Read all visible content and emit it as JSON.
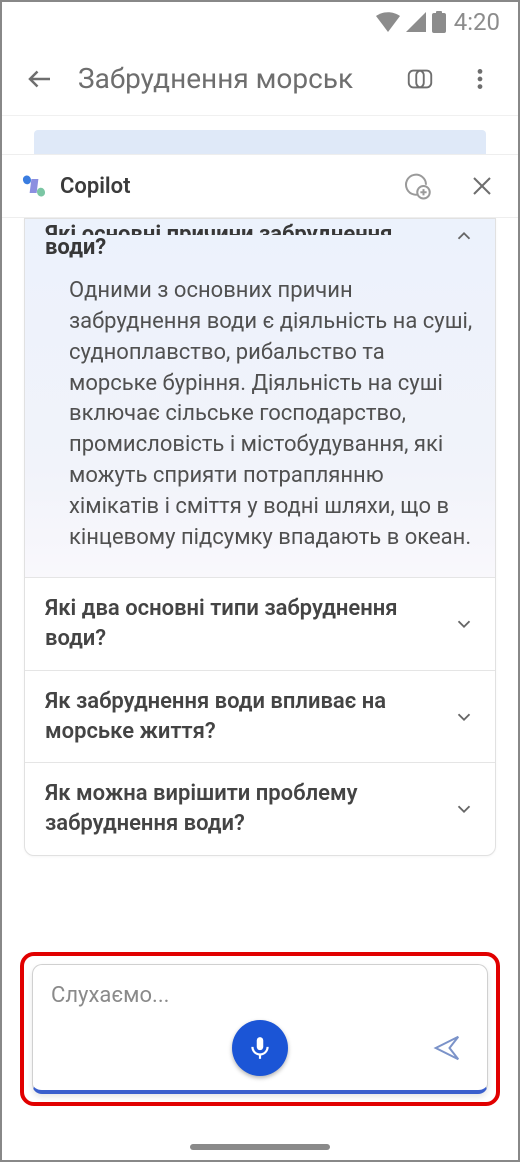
{
  "status": {
    "time": "4:20"
  },
  "app_header": {
    "title": "Забруднення морськ"
  },
  "panel": {
    "title": "Copilot"
  },
  "accordion": {
    "expanded": {
      "title_visible": "Які основні причини забруднення води?",
      "title_truncated_line": "Які основні причини забруднення",
      "title_truncated_tail": "води?",
      "body": "Одними з основних причин забруднення води є діяльність на суші, судноплавство, рибальство та морське буріння. Діяльність на суші включає сільське господарство, промисловість і містобудування, які можуть сприяти потраплянню хімікатів і сміття у водні шляхи, що в кінцевому підсумку впадають в океан."
    },
    "items": [
      {
        "title": "Які два основні типи забруднення води?"
      },
      {
        "title": "Як забруднення води впливає на морське життя?"
      },
      {
        "title": "Як можна вирішити проблему забруднення води?"
      }
    ]
  },
  "input": {
    "listening": "Слухаємо..."
  }
}
